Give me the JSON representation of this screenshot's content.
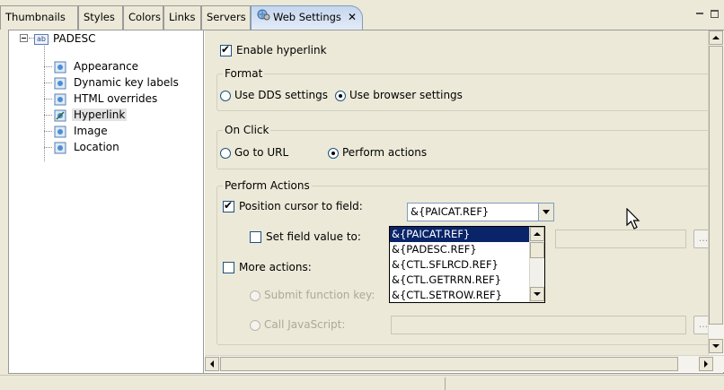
{
  "tabs": [
    {
      "label": "Thumbnails"
    },
    {
      "label": "Styles"
    },
    {
      "label": "Colors"
    },
    {
      "label": "Links"
    },
    {
      "label": "Servers"
    },
    {
      "label": "Web Settings",
      "active": true
    }
  ],
  "window_controls": {
    "minimize_icon": "minimize-icon",
    "maximize_icon": "maximize-icon"
  },
  "tree": {
    "root": {
      "icon": "ab-field-icon",
      "icon_text": "ab",
      "label": "PADESC"
    },
    "children": [
      {
        "label": "Appearance",
        "icon": "page-icon"
      },
      {
        "label": "Dynamic key labels",
        "icon": "page-icon"
      },
      {
        "label": "HTML overrides",
        "icon": "page-icon"
      },
      {
        "label": "Hyperlink",
        "icon": "hyperlink-page-icon",
        "selected": true
      },
      {
        "label": "Image",
        "icon": "page-icon"
      },
      {
        "label": "Location",
        "icon": "page-icon"
      }
    ]
  },
  "hyperlink": {
    "enable_label": "Enable hyperlink",
    "enable_checked": true,
    "format": {
      "title": "Format",
      "option_dds": "Use DDS settings",
      "option_browser": "Use browser settings",
      "selected": "browser"
    },
    "on_click": {
      "title": "On Click",
      "option_url": "Go to URL",
      "option_actions": "Perform actions",
      "selected": "actions"
    },
    "perform_actions": {
      "title": "Perform Actions",
      "position_cursor_label": "Position cursor to field:",
      "position_cursor_checked": true,
      "position_cursor_value": "&{PAICAT.REF}",
      "set_field_label": "Set field value to:",
      "set_field_checked": false,
      "more_actions_label": "More actions:",
      "more_actions_checked": false,
      "submit_key_label": "Submit function key:",
      "call_js_label": "Call JavaScript:",
      "browse_label": "..."
    }
  },
  "dropdown_options": [
    "&{PAICAT.REF}",
    "&{PADESC.REF}",
    "&{CTL.SFLRCD.REF}",
    "&{CTL.GETRRN.REF}",
    "&{CTL.SETROW.REF}"
  ],
  "dropdown_selected_index": 0,
  "colors": {
    "selection": "#0a246a",
    "panel": "#ece9d8",
    "active_tab": "#c4d6ee"
  }
}
